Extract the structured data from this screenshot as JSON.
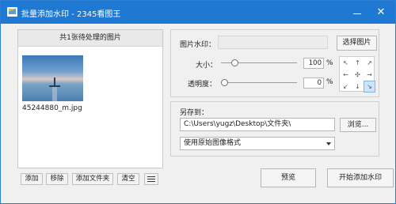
{
  "window": {
    "title": "批量添加水印 - 2345看图王",
    "minimize_icon": "minimize-icon",
    "close_icon": "close-icon",
    "close_glyph": "✕"
  },
  "image_list": {
    "header": "共1张待处理的图片",
    "items": [
      {
        "file_name": "45244880_m.jpg"
      }
    ],
    "buttons": {
      "add": "添加",
      "remove": "移除",
      "add_folder": "添加文件夹",
      "clear": "清空",
      "list_view_icon": "list-icon"
    }
  },
  "watermark": {
    "image_label": "图片水印：",
    "image_value": "",
    "pick_button": "选择图片",
    "size_label": "大小：",
    "size_value": "100",
    "size_unit": "%",
    "size_level": 0.15,
    "opacity_label": "透明度：",
    "opacity_value": "0",
    "opacity_unit": "%",
    "opacity_level": 0.0,
    "position_grid": [
      {
        "name": "top-left",
        "glyph": "↖",
        "selected": false
      },
      {
        "name": "top-center",
        "glyph": "↑",
        "selected": false
      },
      {
        "name": "top-right",
        "glyph": "↗",
        "selected": false
      },
      {
        "name": "middle-left",
        "glyph": "←",
        "selected": false
      },
      {
        "name": "center",
        "glyph": "✣",
        "selected": false
      },
      {
        "name": "middle-right",
        "glyph": "→",
        "selected": false
      },
      {
        "name": "bottom-left",
        "glyph": "↙",
        "selected": false
      },
      {
        "name": "bottom-center",
        "glyph": "↓",
        "selected": false
      },
      {
        "name": "bottom-right",
        "glyph": "↘",
        "selected": true
      }
    ]
  },
  "save": {
    "label": "另存到：",
    "path": "C:\\Users\\yugz\\Desktop\\文件夹\\",
    "browse_button": "浏览...",
    "format_selected": "使用原始图像格式"
  },
  "actions": {
    "preview": "预览",
    "start": "开始添加水印"
  },
  "colors": {
    "titlebar": "#1f78d1",
    "selected_cell": "#cfe4fa"
  }
}
